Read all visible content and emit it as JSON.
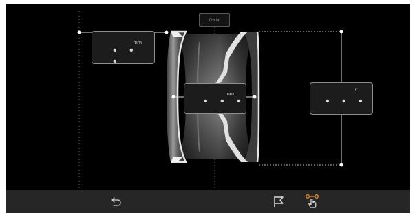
{
  "measurements": {
    "left_width": {
      "value": "• • •",
      "unit": "mm"
    },
    "center_width": {
      "value": "• • •",
      "unit": "mm"
    },
    "diameter": {
      "value": "• • •",
      "unit": "″"
    }
  },
  "mode_button": {
    "label": "DYN"
  },
  "toolbar": {
    "icons": [
      "back-arrow-icon",
      "flag-icon",
      "touch-points-icon"
    ],
    "accent_color": "#e8852c"
  },
  "colors": {
    "background": "#000000",
    "toolbar": "#262626",
    "box_border": "#8e8e8e",
    "guide_lines": "#bfbfbf"
  }
}
